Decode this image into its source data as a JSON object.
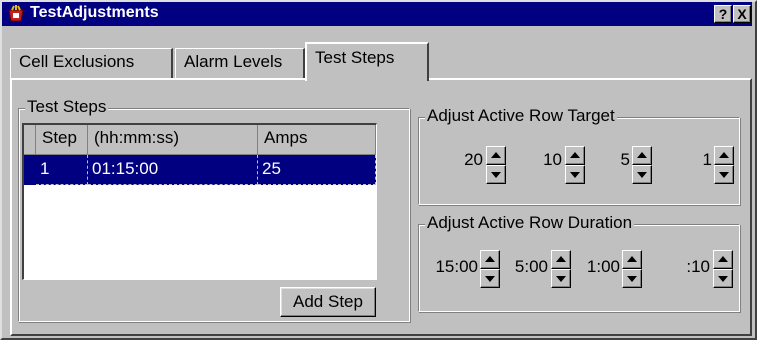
{
  "window": {
    "title": "TestAdjustments",
    "help_label": "?",
    "close_label": "X"
  },
  "tabs": [
    {
      "label": "Cell Exclusions"
    },
    {
      "label": "Alarm Levels"
    },
    {
      "label": "Test Steps",
      "active": true
    }
  ],
  "test_steps": {
    "group_title": "Test Steps",
    "columns": [
      "Step",
      "(hh:mm:ss)",
      "Amps"
    ],
    "rows": [
      {
        "step": "1",
        "time": "01:15:00",
        "amps": "25"
      }
    ],
    "add_step_label": "Add Step"
  },
  "adjust_target": {
    "group_title": "Adjust Active Row Target",
    "steps": [
      "20",
      "10",
      "5",
      "1"
    ]
  },
  "adjust_duration": {
    "group_title": "Adjust Active Row Duration",
    "steps": [
      "15:00",
      "5:00",
      "1:00",
      ":10"
    ]
  },
  "colors": {
    "titlebar": "#000080",
    "selection": "#000080",
    "face": "#c0c0c0"
  }
}
